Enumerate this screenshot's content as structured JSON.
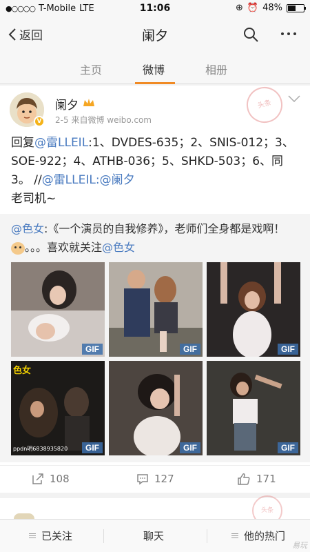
{
  "status_bar": {
    "carrier": "T-Mobile",
    "network": "LTE",
    "time": "11:06",
    "battery_percent": "48%",
    "battery_level": 0.48
  },
  "nav": {
    "back_label": "返回",
    "title": "阑夕"
  },
  "tabs": [
    {
      "label": "主页",
      "active": false
    },
    {
      "label": "微博",
      "active": true
    },
    {
      "label": "相册",
      "active": false
    }
  ],
  "post": {
    "user_name": "阑夕",
    "date": "2-5",
    "source": "来自微博 weibo.com",
    "text_prefix": "回复",
    "mention_1": "@雷LLEIL",
    "text_body": ":1、DVDES-635；2、SNIS-012；3、SOE-922；4、ATHB-036；5、SHKD-503；6、同3。 //",
    "mention_2": "@雷LLEIL",
    "colon": ":",
    "mention_3": "@阑夕",
    "text_tail": "老司机~",
    "stamp_text": "头条"
  },
  "repost": {
    "mention": "@色女",
    "text_1": ":《一个演员的自我修养》，老师们全身都是戏啊！",
    "text_2": "。。。喜欢就关注",
    "mention_2": "@色女",
    "gif_label": "GIF",
    "thumb_4_overlay": "色女",
    "thumb_4_caption": "ppdn明6838935820"
  },
  "actions": {
    "repost_count": "108",
    "comment_count": "127",
    "like_count": "171"
  },
  "bottom_bar": {
    "follow_label": "已关注",
    "chat_label": "聊天",
    "hot_label": "他的热门",
    "watermark": "易玩"
  },
  "colors": {
    "accent": "#f08a24",
    "link": "#4a7bc0",
    "gif_badge": "#3c6eaa"
  }
}
